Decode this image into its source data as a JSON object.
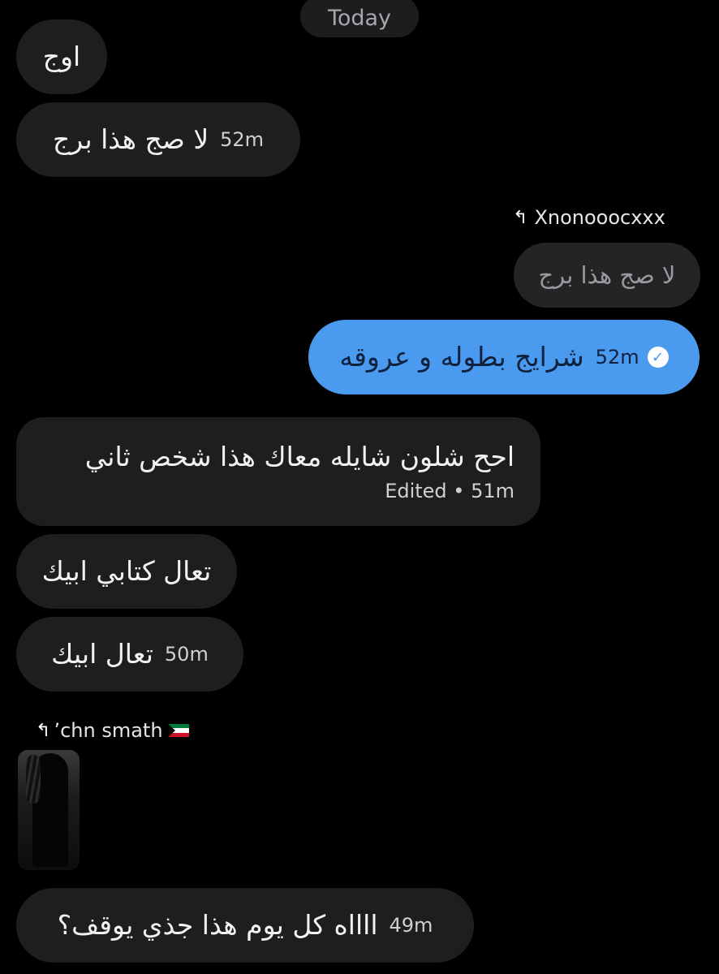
{
  "date_separator": "Today",
  "messages": [
    {
      "text": "اوج",
      "time": ""
    },
    {
      "text": "لا صج هذا برج",
      "time": "52m"
    },
    {
      "reply_to": "Xnonooocxxx",
      "quoted": "لا صج هذا برج",
      "text": "شرايج بطوله و عروقه",
      "time": "52m"
    },
    {
      "text": "احح شلون شايله معاك هذا شخص ثاني",
      "meta": "Edited • 51m"
    },
    {
      "text": "تعال كتابي ابيك",
      "time": ""
    },
    {
      "text": "تعال ابيك",
      "time": "50m"
    },
    {
      "reply_to": "ʼchn smath",
      "text": "ااااه كل يوم هذا جذي يوقف؟",
      "time": "49m"
    }
  ],
  "colors": {
    "background": "#000000",
    "incoming_bubble": "#1e1e20",
    "outgoing_bubble": "#4a9bf0",
    "quoted_bubble": "#242426"
  },
  "icons": [
    "reply-arrow-icon",
    "read-check-icon",
    "kuwait-flag-icon"
  ]
}
